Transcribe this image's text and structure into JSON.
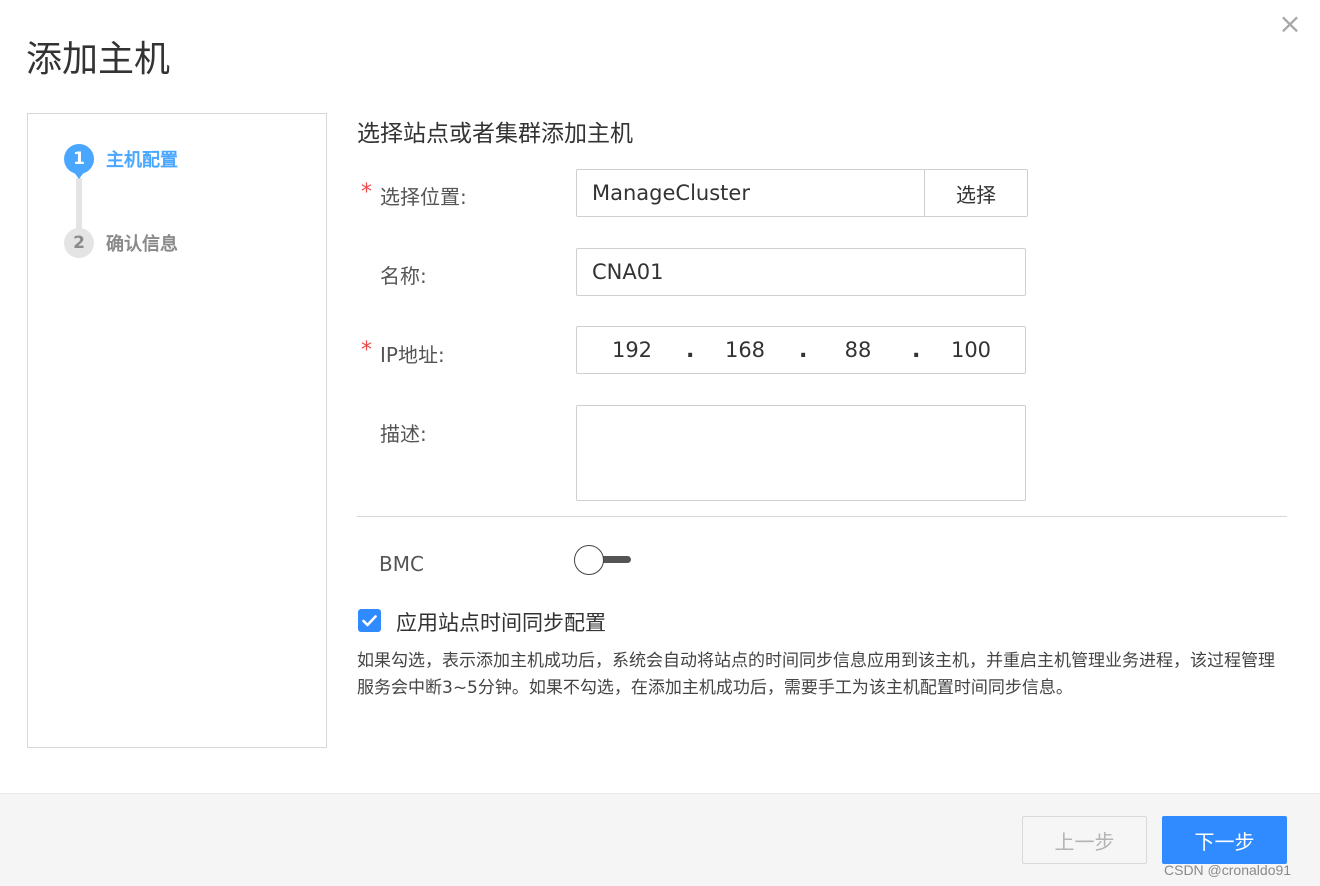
{
  "dialog": {
    "title": "添加主机",
    "close_icon": "×"
  },
  "steps": [
    {
      "number": "1",
      "label": "主机配置",
      "status": "active"
    },
    {
      "number": "2",
      "label": "确认信息",
      "status": "pending"
    }
  ],
  "form": {
    "section_title": "选择站点或者集群添加主机",
    "required_mark": "*",
    "location": {
      "label": "选择位置:",
      "value": "ManageCluster",
      "select_label": "选择"
    },
    "name": {
      "label": "名称:",
      "value": "CNA01"
    },
    "ip": {
      "label": "IP地址:",
      "octets": [
        "192",
        "168",
        "88",
        "100"
      ],
      "separator": "."
    },
    "description": {
      "label": "描述:",
      "value": ""
    },
    "bmc": {
      "label": "BMC",
      "enabled": false
    },
    "sync_time": {
      "checked": true,
      "label": "应用站点时间同步配置",
      "help": "如果勾选，表示添加主机成功后，系统会自动将站点的时间同步信息应用到该主机，并重启主机管理业务进程，该过程管理服务会中断3~5分钟。如果不勾选，在添加主机成功后，需要手工为该主机配置时间同步信息。"
    }
  },
  "footer": {
    "prev_label": "上一步",
    "next_label": "下一步",
    "watermark": "CSDN @cronaldo91"
  },
  "colors": {
    "accent": "#2f8bff",
    "step_active": "#49a7ff",
    "required": "#f04848"
  },
  "icons": {
    "close": "close-icon",
    "check": "check-icon"
  }
}
